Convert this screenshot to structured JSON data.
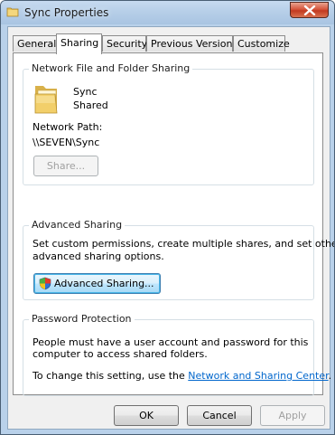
{
  "window": {
    "title": "Sync Properties"
  },
  "tabs": [
    {
      "label": "General"
    },
    {
      "label": "Sharing"
    },
    {
      "label": "Security"
    },
    {
      "label": "Previous Versions"
    },
    {
      "label": "Customize"
    }
  ],
  "network_sharing": {
    "group_title": "Network File and Folder Sharing",
    "folder_name": "Sync",
    "folder_status": "Shared",
    "path_label": "Network Path:",
    "path_value": "\\\\SEVEN\\Sync",
    "share_button": "Share..."
  },
  "advanced_sharing": {
    "group_title": "Advanced Sharing",
    "description_line1": "Set custom permissions, create multiple shares, and set other",
    "description_line2": "advanced sharing options.",
    "button": "Advanced Sharing..."
  },
  "password_protection": {
    "group_title": "Password Protection",
    "line1": "People must have a user account and password for this",
    "line2": "computer to access shared folders.",
    "line3_prefix": "To change this setting, use the",
    "link": "Network and Sharing Center",
    "line3_suffix": "."
  },
  "footer": {
    "ok": "OK",
    "cancel": "Cancel",
    "apply": "Apply"
  },
  "icons": [
    "folder-icon",
    "close-icon",
    "uac-shield-icon"
  ]
}
